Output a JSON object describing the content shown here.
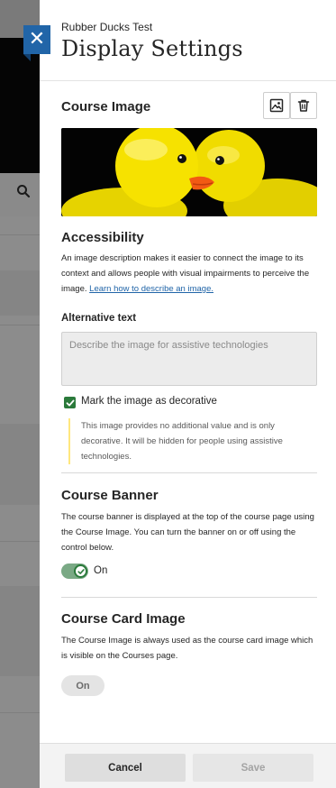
{
  "panel": {
    "breadcrumb": "Rubber Ducks Test",
    "title": "Display Settings"
  },
  "course_image": {
    "heading": "Course Image",
    "replace_icon": "image-icon",
    "delete_icon": "trash-icon"
  },
  "accessibility": {
    "heading": "Accessibility",
    "description": "An image description makes it easier to connect the image to its context and allows people with visual impairments to perceive the image.",
    "link_text": "Learn how to describe an image.",
    "alt_label": "Alternative text",
    "alt_placeholder": "Describe the image for assistive technologies",
    "decorative_label": "Mark the image as decorative",
    "decorative_checked": true,
    "decorative_note": "This image provides no additional value and is only decorative. It will be hidden for people using assistive technologies."
  },
  "course_banner": {
    "heading": "Course Banner",
    "description": "The course banner is displayed at the top of the course page using the Course Image. You can turn the banner on or off using the control below.",
    "toggle_label": "On",
    "toggle_on": true
  },
  "course_card": {
    "heading": "Course Card Image",
    "description": "The Course Image is always used as the course card image which is visible on the Courses page.",
    "state_label": "On"
  },
  "footer": {
    "cancel_label": "Cancel",
    "save_label": "Save"
  },
  "colors": {
    "accent_blue": "#2165a8",
    "success_green": "#2b7a3b",
    "note_border": "#ffe77e"
  }
}
